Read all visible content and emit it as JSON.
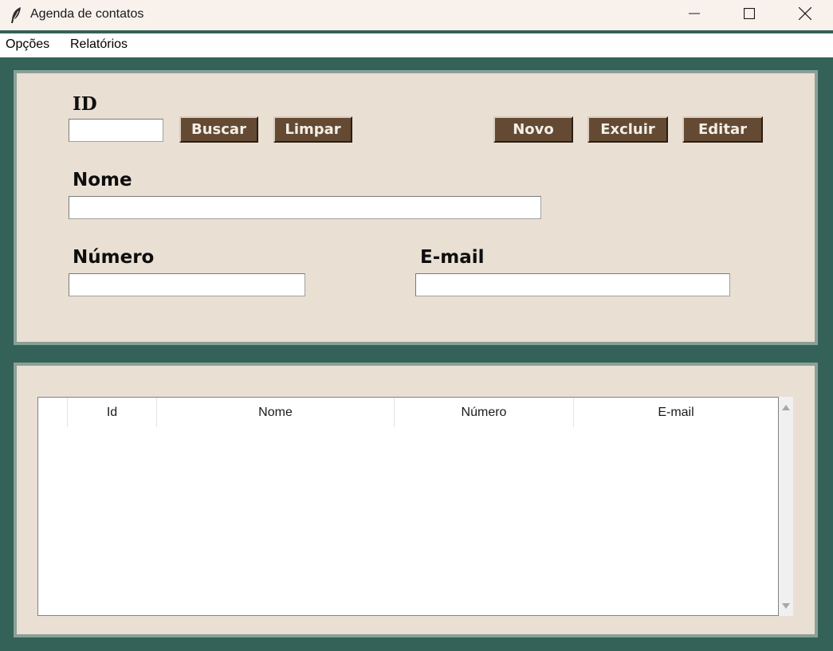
{
  "window": {
    "title": "Agenda de contatos",
    "icon": "feather-icon"
  },
  "menu": {
    "items": [
      "Opções",
      "Relatórios"
    ]
  },
  "form": {
    "id_label": "ID",
    "id_value": "",
    "nome_label": "Nome",
    "nome_value": "",
    "numero_label": "Número",
    "numero_value": "",
    "email_label": "E-mail",
    "email_value": "",
    "buttons": {
      "buscar": "Buscar",
      "limpar": "Limpar",
      "novo": "Novo",
      "excluir": "Excluir",
      "editar": "Editar"
    }
  },
  "table": {
    "columns": [
      "",
      "Id",
      "Nome",
      "Número",
      "E-mail"
    ],
    "rows": []
  },
  "colors": {
    "background": "#346158",
    "panel": "#e9dfd3",
    "panel_border": "#8aa097",
    "button": "#644a33",
    "button_text": "#f3efe8"
  }
}
